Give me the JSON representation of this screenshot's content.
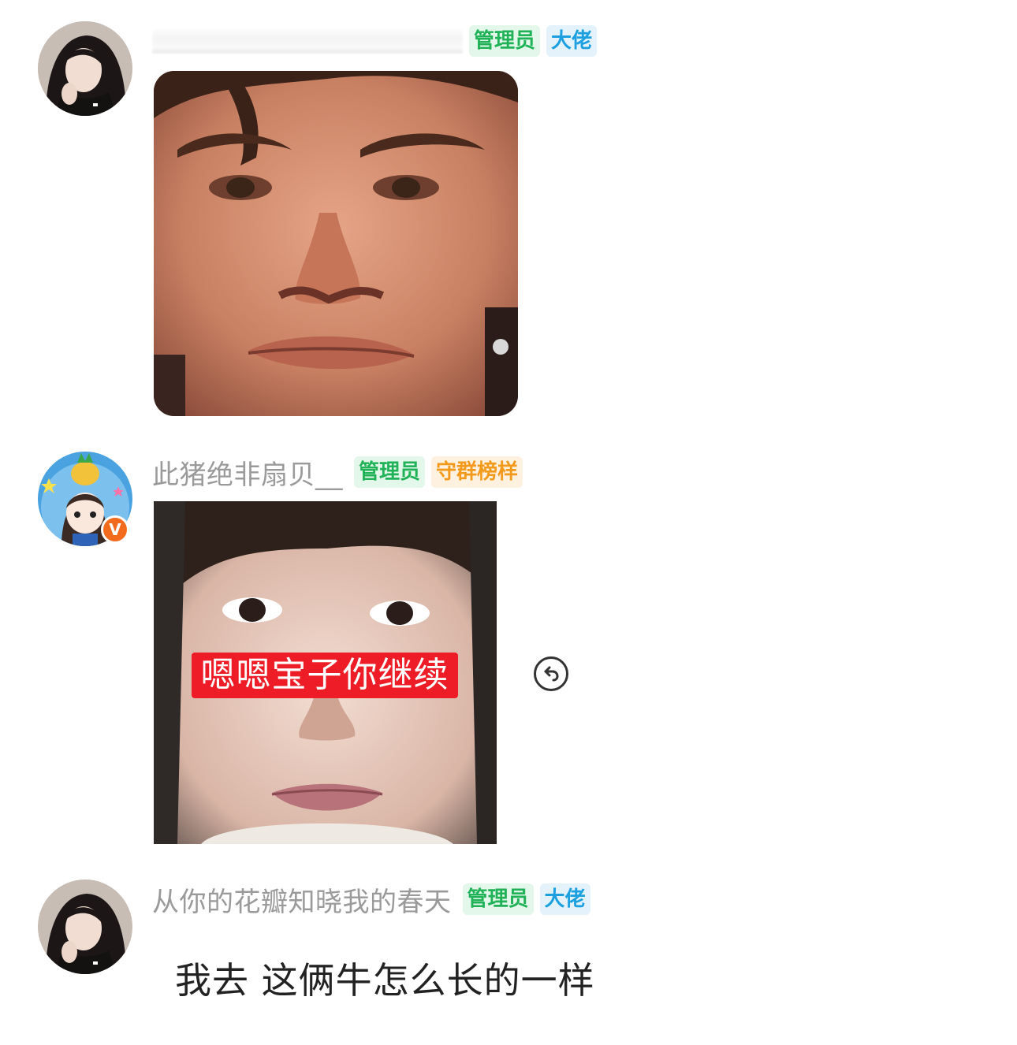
{
  "messages": [
    {
      "sender": "",
      "badges": [
        "管理员",
        "大佬"
      ],
      "content_type": "image",
      "image_description": "close-up face photo"
    },
    {
      "sender": "此猪绝非扇贝__",
      "verified_badge": "V",
      "badges": [
        "管理员",
        "守群榜样"
      ],
      "content_type": "image",
      "image_caption": "嗯嗯宝子你继续"
    },
    {
      "sender": "从你的花瓣知晓我的春天",
      "badges": [
        "管理员",
        "大佬"
      ],
      "content_type": "text",
      "text": "我去 这俩牛怎么长的一样"
    }
  ],
  "icons": {
    "share": "reply-share-icon"
  },
  "colors": {
    "admin_badge_bg": "#e3f7ea",
    "admin_badge_text": "#1fb257",
    "boss_badge_bg": "#e3f2fb",
    "boss_badge_text": "#1ca0e0",
    "guard_badge_bg": "#fff1e0",
    "guard_badge_text": "#f39a1d",
    "caption_bg": "#ee1c26",
    "verified_badge": "#f26b1d"
  }
}
